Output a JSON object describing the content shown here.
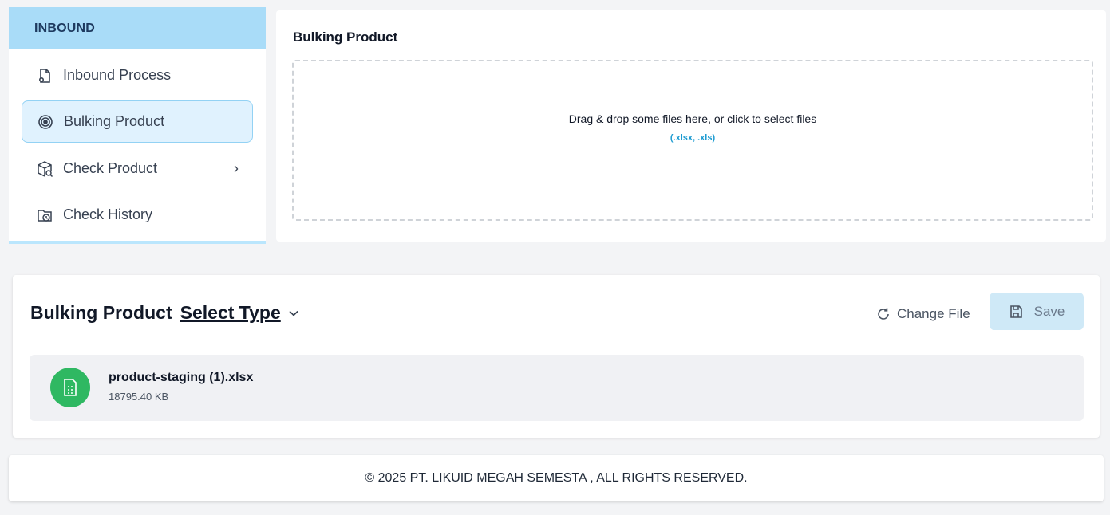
{
  "sidebar": {
    "header": "INBOUND",
    "items": [
      {
        "label": "Inbound Process",
        "icon": "document-icon"
      },
      {
        "label": "Bulking Product",
        "icon": "target-icon",
        "active": true
      },
      {
        "label": "Check Product",
        "icon": "package-search-icon",
        "chevron": "›"
      },
      {
        "label": "Check History",
        "icon": "folder-clock-icon"
      }
    ]
  },
  "upload": {
    "title": "Bulking Product",
    "drop_text": "Drag & drop some files here, or click to select files",
    "accepted_types": "(.xlsx, .xls)"
  },
  "file_panel": {
    "title": "Bulking Product",
    "select_type": "Select Type",
    "caret": "⌄",
    "change_file": "Change File",
    "save": "Save",
    "file": {
      "name": "product-staging (1).xlsx",
      "size": "18795.40 KB"
    }
  },
  "footer": {
    "text": "© 2025 PT. LIKUID MEGAH SEMESTA , ALL RIGHTS RESERVED."
  },
  "colors": {
    "sidebar_header_bg": "#a9dcf8",
    "active_item_bg": "#e0f2fe",
    "accent_blue": "#1d9bd1",
    "file_icon_green": "#2fb862",
    "save_button_bg": "#cfe9f7"
  }
}
